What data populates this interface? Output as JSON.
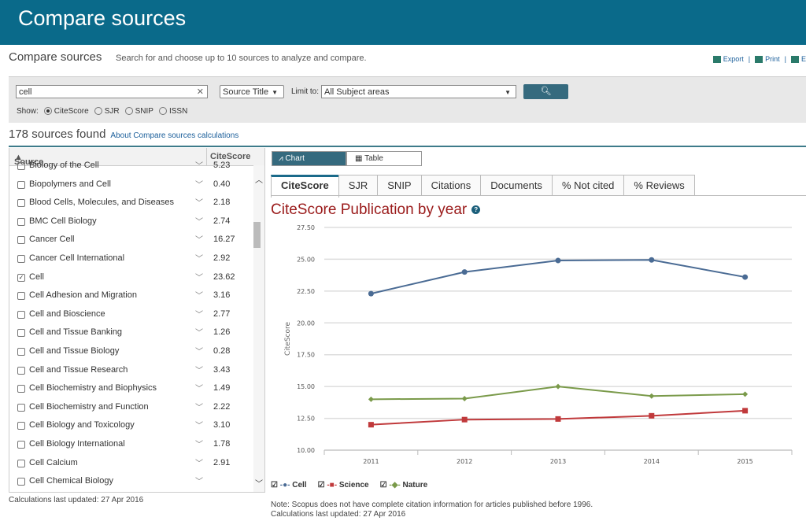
{
  "banner": {
    "title": "Compare sources"
  },
  "header": {
    "title": "Compare sources",
    "subtitle": "Search for and choose up to 10 sources to analyze and compare.",
    "tools": [
      "Export",
      "Print",
      "E"
    ]
  },
  "search": {
    "query": "cell",
    "search_type": "Source Title",
    "limit_label": "Limit to:",
    "limit_value": "All Subject areas",
    "show_label": "Show:",
    "show_options": [
      "CiteScore",
      "SJR",
      "SNIP",
      "ISSN"
    ],
    "show_selected": "CiteScore"
  },
  "results": {
    "count_text": "178 sources found",
    "about_link": "About Compare sources calculations"
  },
  "list": {
    "col_source": "Source",
    "col_score": "CiteScore",
    "footer": "Calculations last updated: 27 Apr 2016",
    "rows": [
      {
        "name": "Biology of the Cell",
        "score": "5.23",
        "checked": false
      },
      {
        "name": "Biopolymers and Cell",
        "score": "0.40",
        "checked": false
      },
      {
        "name": "Blood Cells, Molecules, and Diseases",
        "score": "2.18",
        "checked": false
      },
      {
        "name": "BMC Cell Biology",
        "score": "2.74",
        "checked": false
      },
      {
        "name": "Cancer Cell",
        "score": "16.27",
        "checked": false
      },
      {
        "name": "Cancer Cell International",
        "score": "2.92",
        "checked": false
      },
      {
        "name": "Cell",
        "score": "23.62",
        "checked": true
      },
      {
        "name": "Cell Adhesion and Migration",
        "score": "3.16",
        "checked": false
      },
      {
        "name": "Cell and Bioscience",
        "score": "2.77",
        "checked": false
      },
      {
        "name": "Cell and Tissue Banking",
        "score": "1.26",
        "checked": false
      },
      {
        "name": "Cell and Tissue Biology",
        "score": "0.28",
        "checked": false
      },
      {
        "name": "Cell and Tissue Research",
        "score": "3.43",
        "checked": false
      },
      {
        "name": "Cell Biochemistry and Biophysics",
        "score": "1.49",
        "checked": false
      },
      {
        "name": "Cell Biochemistry and Function",
        "score": "2.22",
        "checked": false
      },
      {
        "name": "Cell Biology and Toxicology",
        "score": "3.10",
        "checked": false
      },
      {
        "name": "Cell Biology International",
        "score": "1.78",
        "checked": false
      },
      {
        "name": "Cell Calcium",
        "score": "2.91",
        "checked": false
      },
      {
        "name": "Cell Chemical Biology",
        "score": "",
        "checked": false
      }
    ]
  },
  "view": {
    "chart": "Chart",
    "table": "Table",
    "tabs": [
      "CiteScore",
      "SJR",
      "SNIP",
      "Citations",
      "Documents",
      "% Not cited",
      "% Reviews"
    ],
    "active_tab": "CiteScore"
  },
  "chart_title": "CiteScore Publication by year",
  "chart_data": {
    "type": "line",
    "ylabel": "CiteScore",
    "ylim": [
      10,
      27.5
    ],
    "yticks": [
      "10.00",
      "12.50",
      "15.00",
      "17.50",
      "20.00",
      "22.50",
      "25.00",
      "27.50"
    ],
    "categories": [
      "2011",
      "2012",
      "2013",
      "2014",
      "2015"
    ],
    "grid": true,
    "legend": "bottom-left",
    "series": [
      {
        "name": "Cell",
        "color": "#4a6b94",
        "marker": "circle",
        "values": [
          22.3,
          24.0,
          24.9,
          24.95,
          23.6
        ]
      },
      {
        "name": "Science",
        "color": "#c0393b",
        "marker": "square",
        "values": [
          12.0,
          12.4,
          12.45,
          12.7,
          13.1
        ]
      },
      {
        "name": "Nature",
        "color": "#7a9a4a",
        "marker": "diamond",
        "values": [
          14.0,
          14.05,
          15.0,
          14.25,
          14.4
        ]
      }
    ]
  },
  "notes": {
    "line1": "Note: Scopus does not have complete citation information for articles published before 1996.",
    "line2": "Calculations last updated: 27 Apr 2016"
  }
}
